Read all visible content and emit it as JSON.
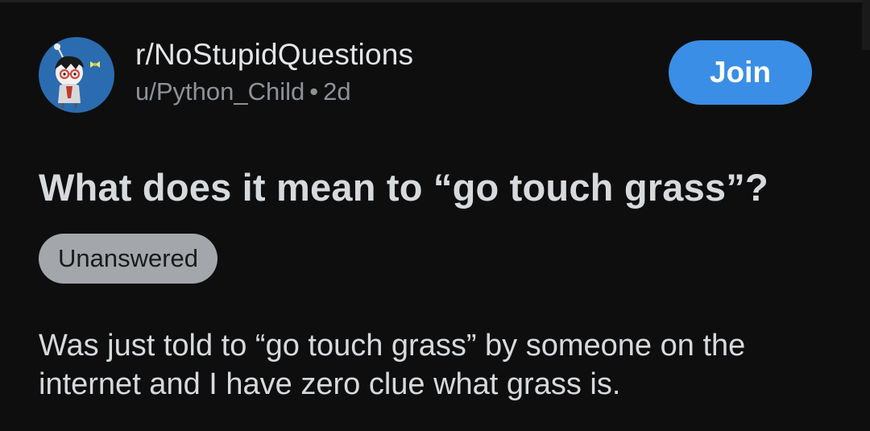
{
  "post": {
    "subreddit": "r/NoStupidQuestions",
    "author": "u/Python_Child",
    "separator": "•",
    "age": "2d",
    "join_label": "Join",
    "title": "What does it mean to “go touch grass”?",
    "flair": "Unanswered",
    "body": "Was just told to “go touch grass” by someone on the internet and I have zero clue what grass is."
  },
  "colors": {
    "background": "#0e0e0f",
    "join_button": "#3a8ee6",
    "flair": "#a3a7ab",
    "avatar_bg": "#2b6cb0"
  },
  "icons": {
    "avatar": "subreddit-avatar-icon"
  }
}
